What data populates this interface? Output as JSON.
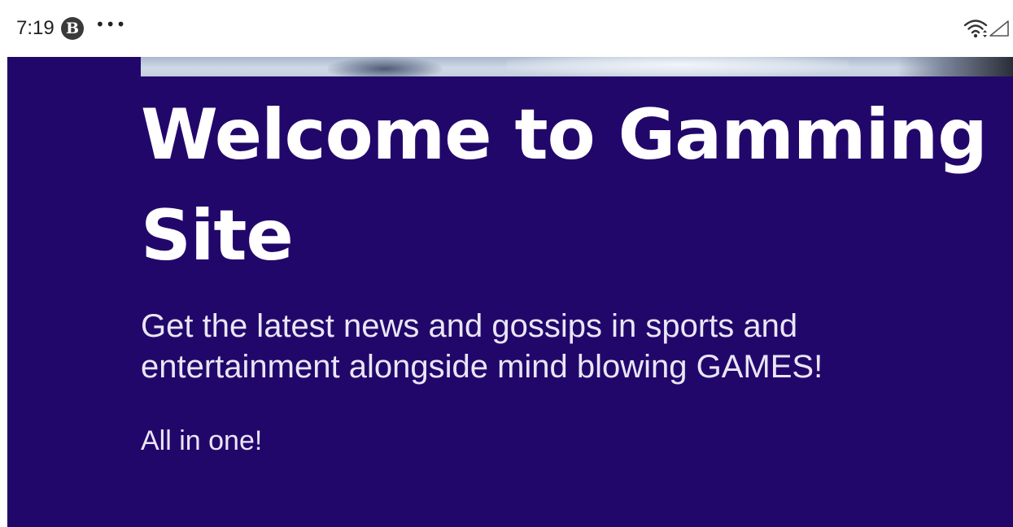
{
  "status_bar": {
    "time": "7:19",
    "app_badge_letter": "B",
    "more_glyph": "•••",
    "icons": [
      "wifi-icon",
      "signal-icon"
    ]
  },
  "hero": {
    "title": "Welcome to Gamming Site",
    "subtitle": "Get the latest news and gossips in sports and entertainment alongside mind blowing GAMES!",
    "tagline": "All in one!"
  },
  "colors": {
    "hero_background": "#22076b",
    "text": "#ffffff",
    "status_bar_background": "#ffffff"
  }
}
